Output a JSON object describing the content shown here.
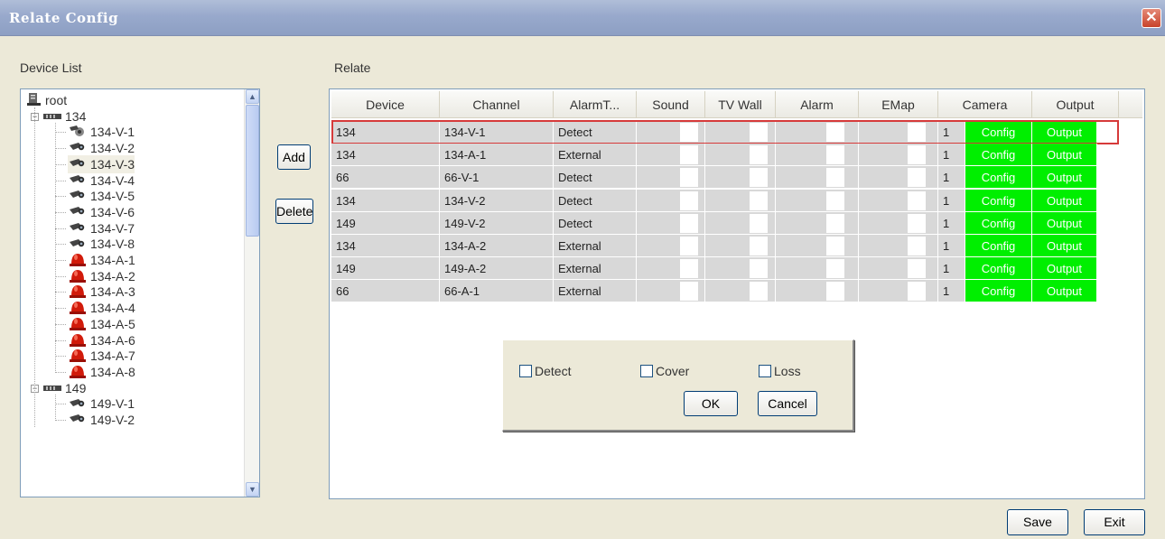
{
  "window": {
    "title": "Relate Config",
    "close_glyph": "✕"
  },
  "labels": {
    "device_list": "Device List",
    "relate": "Relate"
  },
  "tree": {
    "root": "root",
    "groups": [
      {
        "name": "134",
        "items": [
          {
            "label": "134-V-1",
            "icon": "ptz-camera-icon"
          },
          {
            "label": "134-V-2",
            "icon": "camera-icon"
          },
          {
            "label": "134-V-3",
            "icon": "camera-icon",
            "selected": true
          },
          {
            "label": "134-V-4",
            "icon": "camera-icon"
          },
          {
            "label": "134-V-5",
            "icon": "camera-icon"
          },
          {
            "label": "134-V-6",
            "icon": "camera-icon"
          },
          {
            "label": "134-V-7",
            "icon": "camera-icon"
          },
          {
            "label": "134-V-8",
            "icon": "camera-icon"
          },
          {
            "label": "134-A-1",
            "icon": "alarm-icon"
          },
          {
            "label": "134-A-2",
            "icon": "alarm-icon"
          },
          {
            "label": "134-A-3",
            "icon": "alarm-icon"
          },
          {
            "label": "134-A-4",
            "icon": "alarm-icon"
          },
          {
            "label": "134-A-5",
            "icon": "alarm-icon"
          },
          {
            "label": "134-A-6",
            "icon": "alarm-icon"
          },
          {
            "label": "134-A-7",
            "icon": "alarm-icon"
          },
          {
            "label": "134-A-8",
            "icon": "alarm-icon"
          }
        ]
      },
      {
        "name": "149",
        "items": [
          {
            "label": "149-V-1",
            "icon": "camera-icon"
          },
          {
            "label": "149-V-2",
            "icon": "camera-icon"
          }
        ]
      }
    ]
  },
  "buttons": {
    "add": "Add",
    "delete": "Delete",
    "save": "Save",
    "exit": "Exit"
  },
  "table": {
    "columns": [
      "Device",
      "Channel",
      "AlarmT...",
      "Sound",
      "TV Wall",
      "Alarm",
      "EMap",
      "Camera",
      "Output"
    ],
    "rows": [
      {
        "device": "134",
        "channel": "134-V-1",
        "alarm_type": "Detect",
        "camera": "1",
        "config": "Config",
        "output": "Output",
        "selected": true
      },
      {
        "device": "134",
        "channel": "134-A-1",
        "alarm_type": "External",
        "camera": "1",
        "config": "Config",
        "output": "Output"
      },
      {
        "device": "66",
        "channel": "66-V-1",
        "alarm_type": "Detect",
        "camera": "1",
        "config": "Config",
        "output": "Output"
      },
      {
        "device": "134",
        "channel": "134-V-2",
        "alarm_type": "Detect",
        "camera": "1",
        "config": "Config",
        "output": "Output"
      },
      {
        "device": "149",
        "channel": "149-V-2",
        "alarm_type": "Detect",
        "camera": "1",
        "config": "Config",
        "output": "Output"
      },
      {
        "device": "134",
        "channel": "134-A-2",
        "alarm_type": "External",
        "camera": "1",
        "config": "Config",
        "output": "Output"
      },
      {
        "device": "149",
        "channel": "149-A-2",
        "alarm_type": "External",
        "camera": "1",
        "config": "Config",
        "output": "Output"
      },
      {
        "device": "66",
        "channel": "66-A-1",
        "alarm_type": "External",
        "camera": "1",
        "config": "Config",
        "output": "Output"
      }
    ]
  },
  "popup": {
    "options": [
      {
        "label": "Detect",
        "checked": false
      },
      {
        "label": "Cover",
        "checked": false
      },
      {
        "label": "Loss",
        "checked": false
      }
    ],
    "ok": "OK",
    "cancel": "Cancel"
  },
  "colors": {
    "titlebar": "#98a9cc",
    "config_green": "#00ef00",
    "selection_red": "#d63a3a",
    "row_gray": "#d8d8d8",
    "dialog_bg": "#ece9d8"
  }
}
